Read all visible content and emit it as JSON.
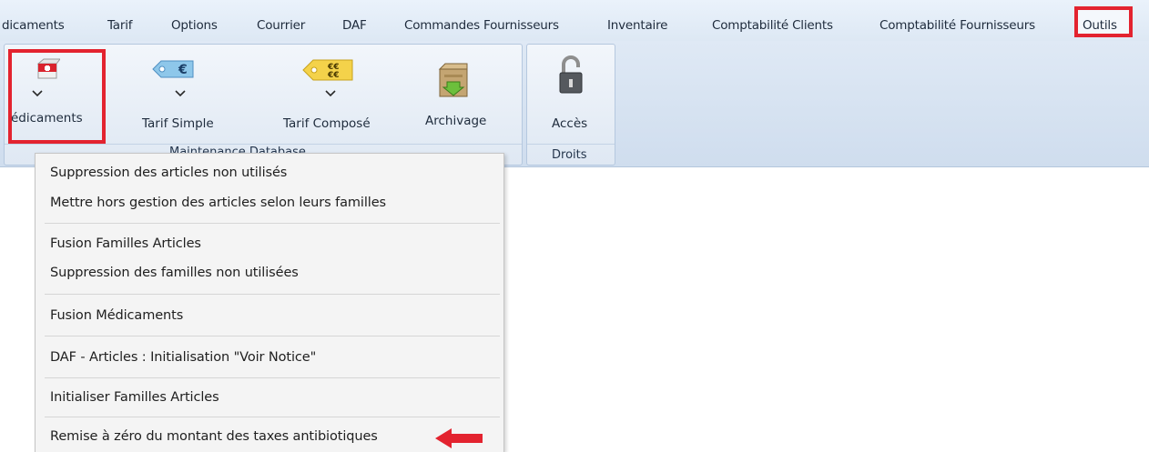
{
  "menubar": {
    "tabs": [
      {
        "label": "dicaments"
      },
      {
        "label": "Tarif"
      },
      {
        "label": "Options"
      },
      {
        "label": "Courrier"
      },
      {
        "label": "DAF"
      },
      {
        "label": "Commandes Fournisseurs"
      },
      {
        "label": "Inventaire"
      },
      {
        "label": "Comptabilité Clients"
      },
      {
        "label": "Comptabilité Fournisseurs"
      },
      {
        "label": "Outils"
      }
    ]
  },
  "ribbon": {
    "buttons": {
      "medicaments": "édicaments",
      "tarif_simple": "Tarif Simple",
      "tarif_compose": "Tarif Composé",
      "archivage": "Archivage",
      "acces": "Accès"
    },
    "groups": {
      "maintenance": "Maintenance Database",
      "droits": "Droits"
    },
    "icons": {
      "medicaments": "medicine-box-icon",
      "tarif_simple": "euro-price-tag-icon",
      "tarif_compose": "multi-euro-price-tag-icon",
      "archivage": "archive-box-icon",
      "acces": "padlock-icon"
    }
  },
  "dropdown": {
    "items": [
      "Suppression des articles non utilisés",
      "Mettre hors gestion des articles selon leurs familles",
      "Fusion Familles Articles",
      "Suppression des familles non utilisées",
      "Fusion Médicaments",
      "DAF - Articles : Initialisation \"Voir Notice\"",
      "Initialiser Familles Articles",
      "Remise à zéro du montant des taxes antibiotiques"
    ]
  },
  "highlight_color": "#e3232f"
}
